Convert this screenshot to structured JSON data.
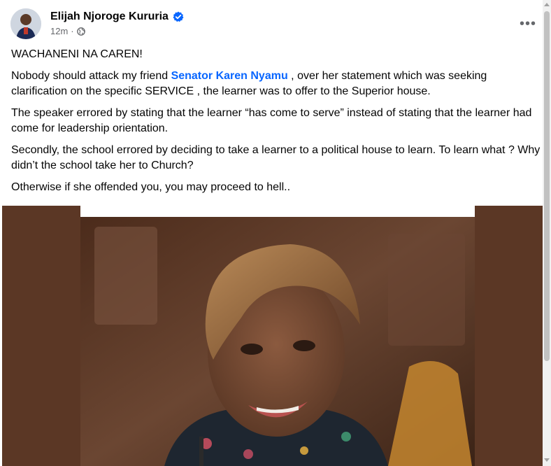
{
  "post": {
    "author_name": "Elijah Njoroge Kururia",
    "timestamp": "12m",
    "privacy_icon": "globe-icon",
    "verified_icon": "verified-badge-icon",
    "more_label": "•••",
    "paragraphs": {
      "p1": "WACHANENI NA CAREN!",
      "p2_before": "Nobody should attack my friend ",
      "p2_mention": "Senator Karen Nyamu",
      "p2_after": " , over her statement which was seeking clarification on the specific SERVICE , the learner was to offer to the Superior house.",
      "p3": "The speaker errored by stating that the learner “has come to serve” instead of stating that the learner had come for leadership orientation.",
      "p4": "Secondly, the school errored by deciding to take a learner to a political house to learn. To learn what ? Why didn’t the school take her to Church?",
      "p5": "Otherwise if she offended you, you may proceed to hell.."
    }
  },
  "colors": {
    "mention": "#0866ff",
    "verified": "#0866ff",
    "media_background": "#5b3725",
    "secondary_text": "#65676b"
  }
}
